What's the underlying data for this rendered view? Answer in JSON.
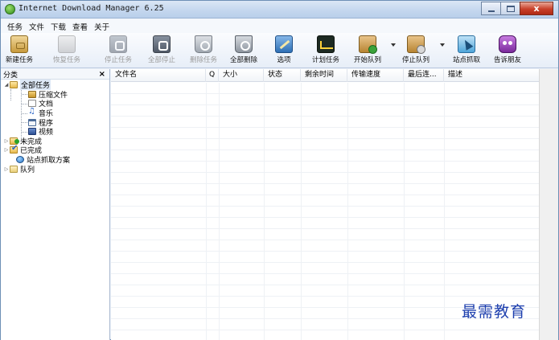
{
  "window": {
    "title": "Internet Download Manager 6.25",
    "close_glyph": "x"
  },
  "menu": [
    "任务",
    "文件",
    "下载",
    "查看",
    "关于"
  ],
  "toolbar": {
    "new_task": "新建任务",
    "resume": "恢复任务",
    "stop": "停止任务",
    "stop_all": "全部停止",
    "delete": "删除任务",
    "delete_all": "全部删除",
    "options": "选项",
    "scheduler": "计划任务",
    "start_queue": "开始队列",
    "stop_queue": "停止队列",
    "site_grabber": "站点抓取",
    "tell_friend": "告诉朋友"
  },
  "categories": {
    "header": "分类",
    "close": "×",
    "all": "全部任务",
    "compressed": "压缩文件",
    "documents": "文档",
    "music": "音乐",
    "programs": "程序",
    "video": "视频",
    "incomplete": "未完成",
    "completed": "已完成",
    "grabber_projects": "站点抓取方案",
    "queues": "队列"
  },
  "list": {
    "columns": [
      "文件名",
      "Q",
      "大小",
      "状态",
      "剩余时间",
      "传输速度",
      "最后连...",
      "描述"
    ]
  },
  "watermark": "最需教育"
}
